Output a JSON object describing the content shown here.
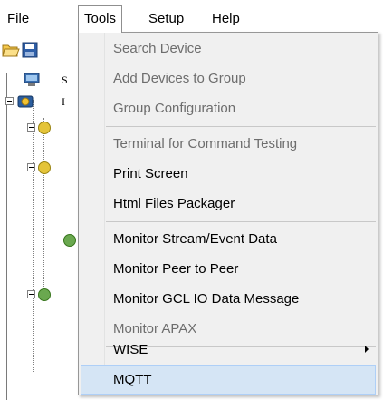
{
  "menubar": {
    "items": [
      {
        "label": "File"
      },
      {
        "label": "Tools"
      },
      {
        "label": "Setup"
      },
      {
        "label": "Help"
      }
    ]
  },
  "tree": {
    "labels": [
      "S",
      "I"
    ]
  },
  "tools_menu": {
    "groups": [
      [
        {
          "label": "Search Device",
          "enabled": false
        },
        {
          "label": "Add Devices to Group",
          "enabled": false
        },
        {
          "label": "Group Configuration",
          "enabled": false
        }
      ],
      [
        {
          "label": "Terminal for Command Testing",
          "enabled": false
        },
        {
          "label": "Print Screen",
          "enabled": true
        },
        {
          "label": "Html Files Packager",
          "enabled": true
        }
      ],
      [
        {
          "label": "Monitor Stream/Event Data",
          "enabled": true
        },
        {
          "label": "Monitor Peer to Peer",
          "enabled": true
        },
        {
          "label": "Monitor GCL IO Data Message",
          "enabled": true
        },
        {
          "label": "Monitor APAX",
          "enabled": false
        }
      ],
      [
        {
          "label": "WISE",
          "enabled": true,
          "submenu": true
        },
        {
          "label": "MQTT",
          "enabled": true,
          "highlighted": true
        }
      ]
    ]
  },
  "colors": {
    "menu_background": "#f0f0f0",
    "highlight": "#d5e5f5",
    "disabled_text": "#6d6d6d"
  }
}
